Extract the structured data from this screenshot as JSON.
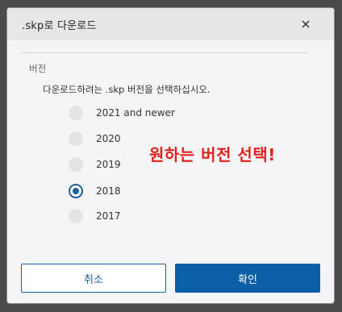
{
  "dialog": {
    "title": ".skp로 다운로드",
    "close_icon": "close-icon",
    "section_label": "버전",
    "instruction": "다운로드하려는 .skp 버전을 선택하십시오.",
    "versions": [
      {
        "label": "2021 and newer",
        "checked": false
      },
      {
        "label": "2020",
        "checked": false
      },
      {
        "label": "2019",
        "checked": false
      },
      {
        "label": "2018",
        "checked": true
      },
      {
        "label": "2017",
        "checked": false
      }
    ],
    "annotation": "원하는 버전 선택!",
    "cancel_label": "취소",
    "ok_label": "확인"
  },
  "colors": {
    "accent": "#0b5fa5",
    "annotation": "#e0211c",
    "title_bar": "#e6e7eb"
  }
}
